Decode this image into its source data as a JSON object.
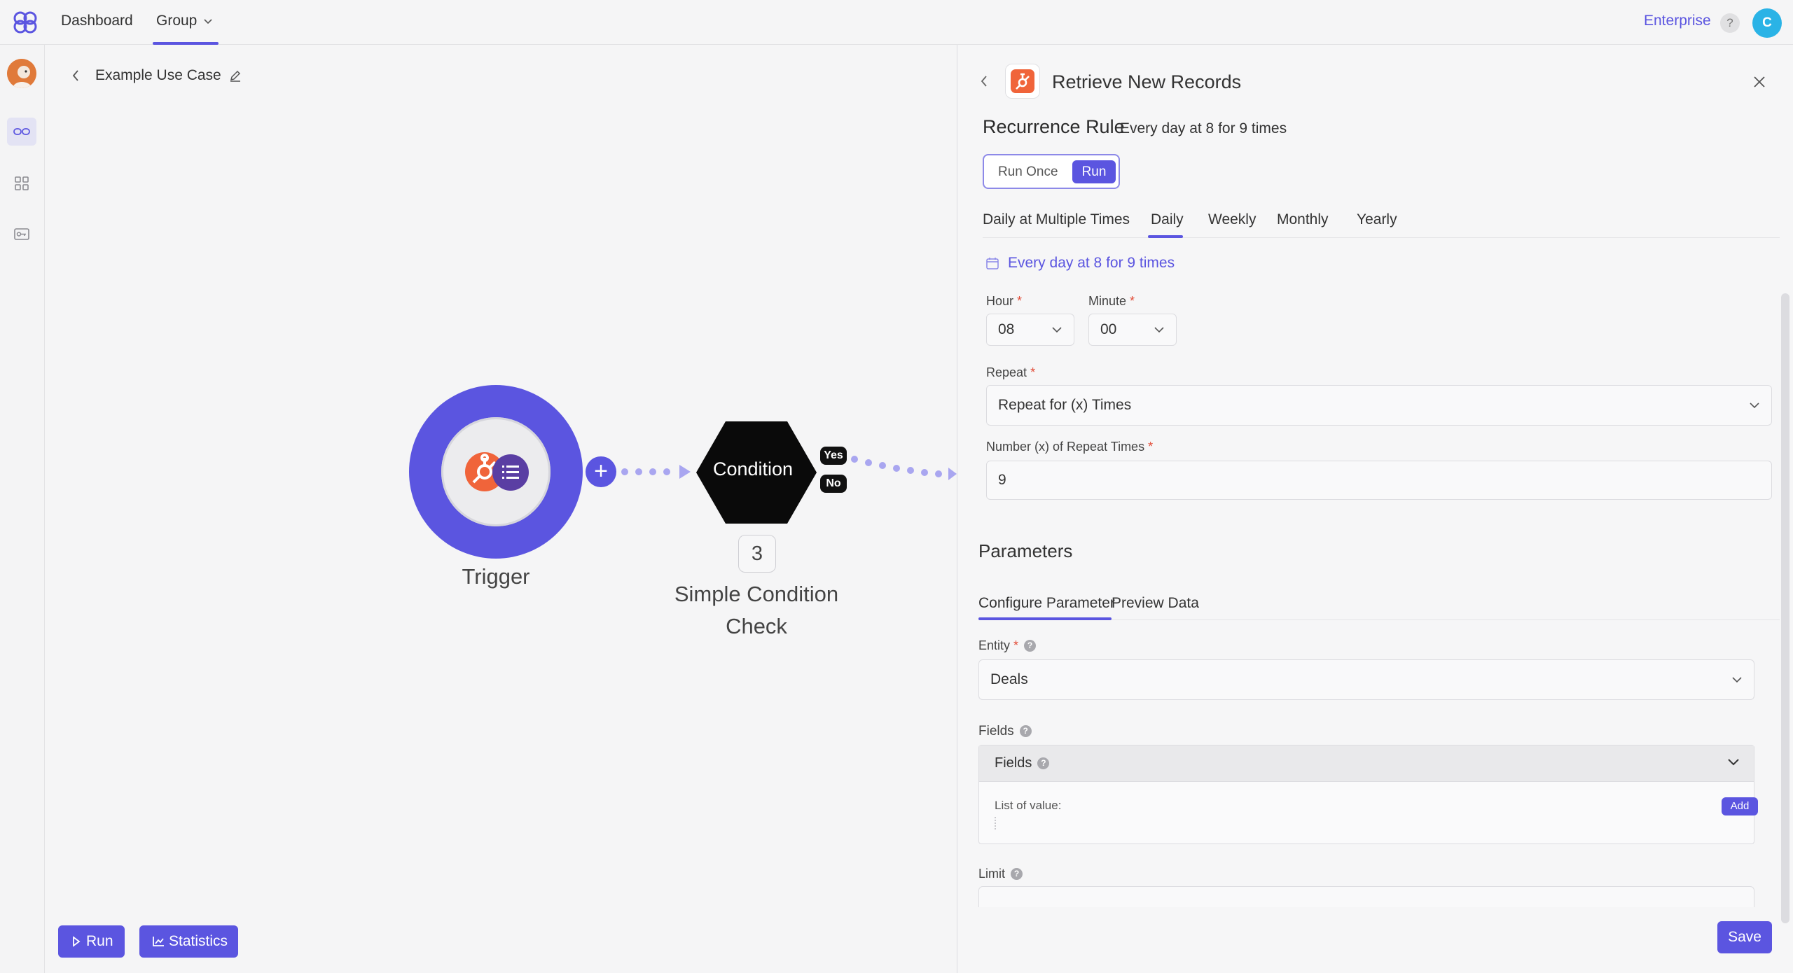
{
  "topnav": {
    "items": [
      {
        "label": "Dashboard"
      },
      {
        "label": "Group"
      }
    ],
    "enterprise": "Enterprise",
    "help": "?",
    "user_initial": "C"
  },
  "canvas": {
    "breadcrumb_title": "Example Use Case",
    "trigger_label": "Trigger",
    "condition_label": "Condition",
    "branch_yes": "Yes",
    "branch_no": "No",
    "step_number": "3",
    "condition_title_line1": "Simple Condition",
    "condition_title_line2": "Check",
    "run_label": "Run",
    "statistics_label": "Statistics"
  },
  "panel": {
    "title": "Retrieve New Records",
    "recurrence_title": "Recurrence Rule",
    "recurrence_summary": "Every day at 8 for 9 times",
    "mode_once": "Run Once",
    "mode_run": "Run",
    "tabs": [
      {
        "label": "Daily at Multiple Times"
      },
      {
        "label": "Daily",
        "active": true
      },
      {
        "label": "Weekly"
      },
      {
        "label": "Monthly"
      },
      {
        "label": "Yearly"
      }
    ],
    "summary_link": "Every day at 8 for 9 times",
    "hour": {
      "label": "Hour",
      "value": "08"
    },
    "minute": {
      "label": "Minute",
      "value": "00"
    },
    "repeat": {
      "label": "Repeat",
      "value": "Repeat for (x) Times"
    },
    "repeat_times": {
      "label": "Number (x) of Repeat Times",
      "value": "9"
    },
    "required_mark": "*",
    "parameters_title": "Parameters",
    "param_tabs": [
      {
        "label": "Configure Parameter",
        "active": true
      },
      {
        "label": "Preview Data"
      }
    ],
    "entity": {
      "label": "Entity",
      "value": "Deals"
    },
    "fields": {
      "label": "Fields",
      "group_label": "Fields",
      "list_label": "List of value:",
      "add_label": "Add"
    },
    "limit": {
      "label": "Limit"
    },
    "save_label": "Save"
  },
  "colors": {
    "accent": "#5b55e0",
    "hubspot": "#f0643a",
    "required": "#e24c38",
    "avatar": "#2ab3e6"
  }
}
